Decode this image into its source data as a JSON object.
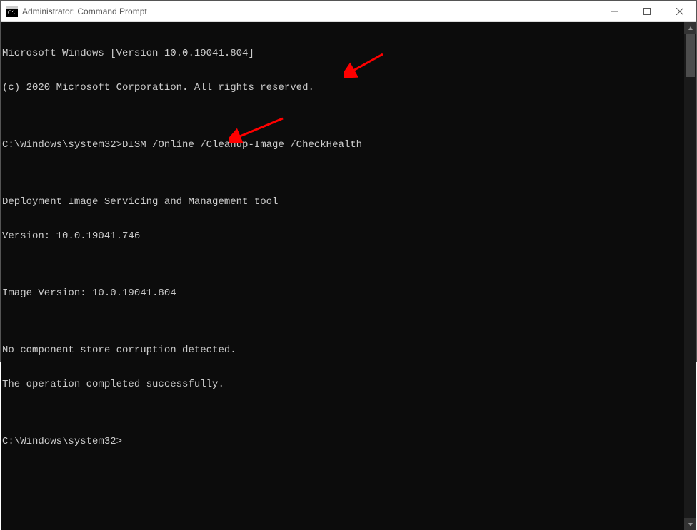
{
  "window": {
    "title": "Administrator: Command Prompt"
  },
  "terminal": {
    "lines": [
      "Microsoft Windows [Version 10.0.19041.804]",
      "(c) 2020 Microsoft Corporation. All rights reserved.",
      "",
      "C:\\Windows\\system32>DISM /Online /Cleanup-Image /CheckHealth",
      "",
      "Deployment Image Servicing and Management tool",
      "Version: 10.0.19041.746",
      "",
      "Image Version: 10.0.19041.804",
      "",
      "No component store corruption detected.",
      "The operation completed successfully.",
      "",
      "C:\\Windows\\system32>"
    ]
  }
}
